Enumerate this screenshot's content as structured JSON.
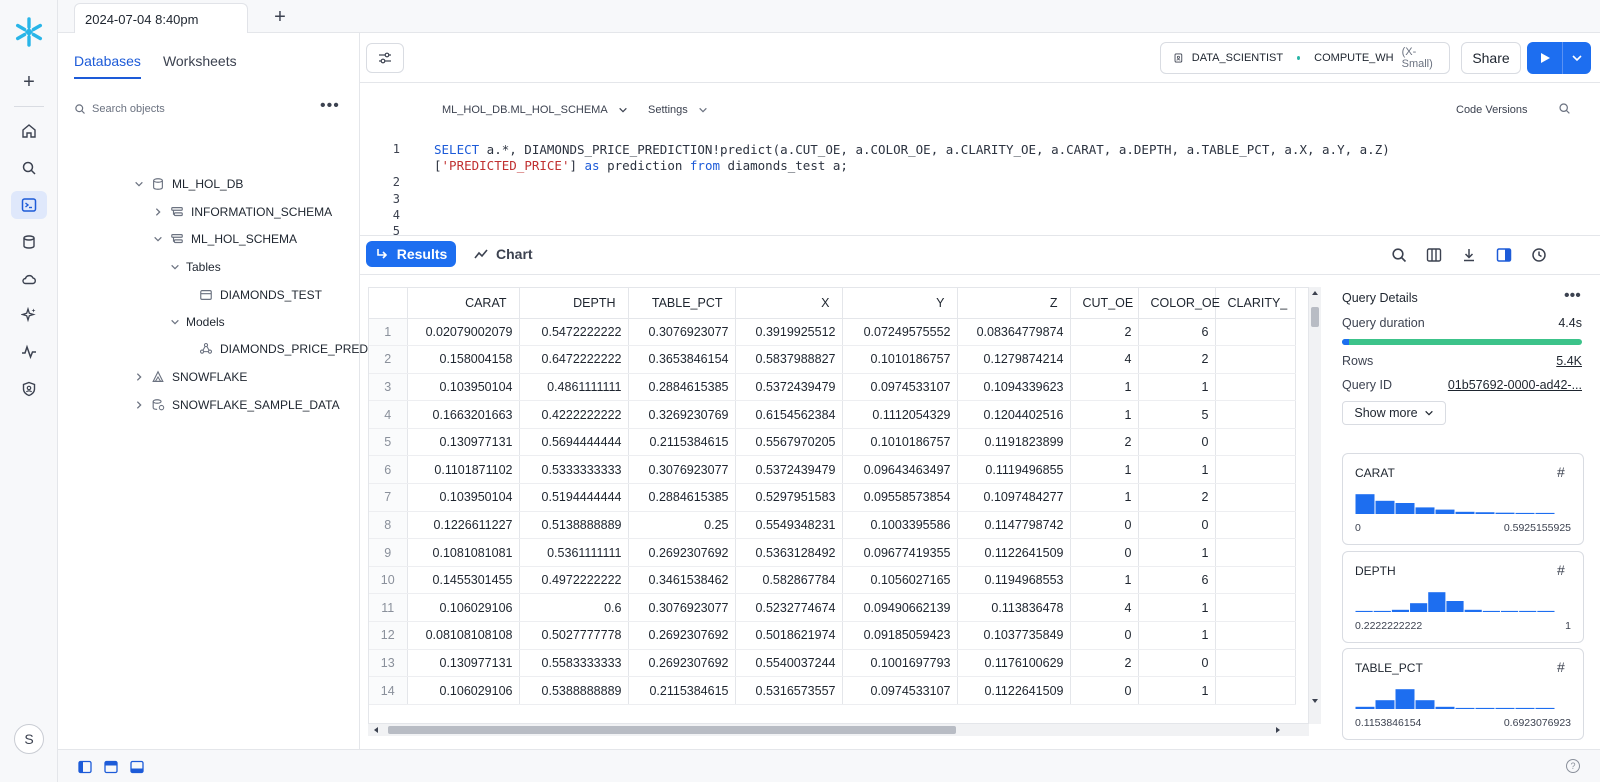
{
  "topbar": {
    "tab_label": "2024-07-04 8:40pm",
    "add_label": "+"
  },
  "rail": {
    "avatar_initial": "S"
  },
  "browser": {
    "tabs": [
      {
        "label": "Databases",
        "active": true
      },
      {
        "label": "Worksheets",
        "active": false
      }
    ],
    "search_placeholder": "Search objects",
    "tree": [
      {
        "label": "ML_HOL_DB",
        "icon": "database-icon",
        "level": 0,
        "expanded": true
      },
      {
        "label": "INFORMATION_SCHEMA",
        "icon": "schema-icon",
        "level": 1,
        "expanded": false
      },
      {
        "label": "ML_HOL_SCHEMA",
        "icon": "schema-icon",
        "level": 1,
        "expanded": true
      },
      {
        "label": "Tables",
        "icon": "",
        "level": 2,
        "expanded": true
      },
      {
        "label": "DIAMONDS_TEST",
        "icon": "table-icon",
        "level": 3,
        "expanded": null
      },
      {
        "label": "Models",
        "icon": "",
        "level": 2,
        "expanded": true
      },
      {
        "label": "DIAMONDS_PRICE_PREDICTI...",
        "icon": "model-icon",
        "level": 3,
        "expanded": null
      },
      {
        "label": "SNOWFLAKE",
        "icon": "snowflake-db-icon",
        "level": 0,
        "expanded": false
      },
      {
        "label": "SNOWFLAKE_SAMPLE_DATA",
        "icon": "shared-db-icon",
        "level": 0,
        "expanded": false
      }
    ]
  },
  "editor": {
    "role": "DATA_SCIENTIST",
    "warehouse": "COMPUTE_WH",
    "warehouse_size": "(X-Small)",
    "share_label": "Share",
    "schema": "ML_HOL_DB.ML_HOL_SCHEMA",
    "settings_label": "Settings",
    "code_versions_label": "Code Versions",
    "line_numbers": [
      "1",
      "2",
      "3",
      "4",
      "5"
    ],
    "code_line1_kw": "SELECT",
    "code_line1_rest": " a.*, DIAMONDS_PRICE_PREDICTION!predict(a.CUT_OE, a.COLOR_OE, a.CLARITY_OE, a.CARAT, a.DEPTH, a.TABLE_PCT, a.X, a.Y, a.Z)",
    "code_line2_open": "[",
    "code_line2_str": "'PREDICTED_PRICE'",
    "code_line2_mid": "] ",
    "code_line2_as": "as",
    "code_line2_pred": " prediction ",
    "code_line2_from": "from",
    "code_line2_end": " diamonds_test a;"
  },
  "results": {
    "results_label": "Results",
    "chart_label": "Chart",
    "columns": [
      "CARAT",
      "DEPTH",
      "TABLE_PCT",
      "X",
      "Y",
      "Z",
      "CUT_OE",
      "COLOR_OE",
      "CLARITY_"
    ],
    "rows": [
      [
        "1",
        "0.02079002079",
        "0.5472222222",
        "0.3076923077",
        "0.3919925512",
        "0.07249575552",
        "0.08364779874",
        "2",
        "6",
        ""
      ],
      [
        "2",
        "0.158004158",
        "0.6472222222",
        "0.3653846154",
        "0.5837988827",
        "0.1010186757",
        "0.1279874214",
        "4",
        "2",
        ""
      ],
      [
        "3",
        "0.103950104",
        "0.4861111111",
        "0.2884615385",
        "0.5372439479",
        "0.0974533107",
        "0.1094339623",
        "1",
        "1",
        ""
      ],
      [
        "4",
        "0.1663201663",
        "0.4222222222",
        "0.3269230769",
        "0.6154562384",
        "0.1112054329",
        "0.1204402516",
        "1",
        "5",
        ""
      ],
      [
        "5",
        "0.130977131",
        "0.5694444444",
        "0.2115384615",
        "0.5567970205",
        "0.1010186757",
        "0.1191823899",
        "2",
        "0",
        ""
      ],
      [
        "6",
        "0.1101871102",
        "0.5333333333",
        "0.3076923077",
        "0.5372439479",
        "0.09643463497",
        "0.1119496855",
        "1",
        "1",
        ""
      ],
      [
        "7",
        "0.103950104",
        "0.5194444444",
        "0.2884615385",
        "0.5297951583",
        "0.09558573854",
        "0.1097484277",
        "1",
        "2",
        ""
      ],
      [
        "8",
        "0.1226611227",
        "0.5138888889",
        "0.25",
        "0.5549348231",
        "0.1003395586",
        "0.1147798742",
        "0",
        "0",
        ""
      ],
      [
        "9",
        "0.1081081081",
        "0.5361111111",
        "0.2692307692",
        "0.5363128492",
        "0.09677419355",
        "0.1122641509",
        "0",
        "1",
        ""
      ],
      [
        "10",
        "0.1455301455",
        "0.4972222222",
        "0.3461538462",
        "0.582867784",
        "0.1056027165",
        "0.1194968553",
        "1",
        "6",
        ""
      ],
      [
        "11",
        "0.106029106",
        "0.6",
        "0.3076923077",
        "0.5232774674",
        "0.09490662139",
        "0.113836478",
        "4",
        "1",
        ""
      ],
      [
        "12",
        "0.08108108108",
        "0.5027777778",
        "0.2692307692",
        "0.5018621974",
        "0.09185059423",
        "0.1037735849",
        "0",
        "1",
        ""
      ],
      [
        "13",
        "0.130977131",
        "0.5583333333",
        "0.2692307692",
        "0.5540037244",
        "0.1001697793",
        "0.1176100629",
        "2",
        "0",
        ""
      ],
      [
        "14",
        "0.106029106",
        "0.5388888889",
        "0.2115384615",
        "0.5316573557",
        "0.0974533107",
        "0.1122641509",
        "0",
        "1",
        ""
      ]
    ]
  },
  "details": {
    "title": "Query Details",
    "duration_label": "Query duration",
    "duration_value": "4.4s",
    "duration_compile_fraction": 0.03,
    "rows_label": "Rows",
    "rows_value": "5.4K",
    "query_id_label": "Query ID",
    "query_id_value": "01b57692-0000-ad42-...",
    "show_more_label": "Show more",
    "cards": [
      {
        "name": "CARAT",
        "min": "0",
        "max": "0.5925155925",
        "bins": [
          0.9,
          0.6,
          0.5,
          0.3,
          0.2,
          0.1,
          0.08,
          0.06,
          0.05,
          0.05
        ]
      },
      {
        "name": "DEPTH",
        "min": "0.2222222222",
        "max": "1",
        "bins": [
          0.05,
          0.05,
          0.1,
          0.4,
          0.9,
          0.5,
          0.1,
          0.05,
          0.05,
          0.05,
          0.05
        ]
      },
      {
        "name": "TABLE_PCT",
        "min": "0.1153846154",
        "max": "0.6923076923",
        "bins": [
          0.1,
          0.4,
          0.9,
          0.4,
          0.1,
          0.05,
          0.05,
          0.05,
          0.05,
          0.05
        ]
      }
    ]
  },
  "status": {
    "help_label": "?"
  }
}
